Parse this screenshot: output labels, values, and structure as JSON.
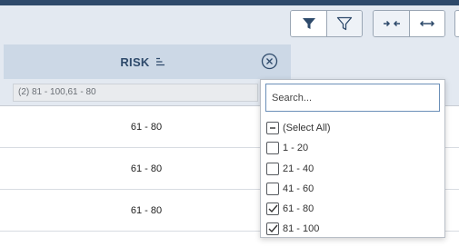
{
  "toolbar": {
    "buttons": [
      {
        "icon": "filter-filled-icon"
      },
      {
        "icon": "filter-outline-icon"
      },
      {
        "icon": "collapse-columns-icon"
      },
      {
        "icon": "expand-columns-icon"
      }
    ]
  },
  "column": {
    "title": "RISK",
    "sort_icon": "sort-lines-icon",
    "close_icon": "close-circle-icon",
    "filter_value": "(2) 81 - 100,61 - 80"
  },
  "rows": [
    {
      "risk": "61 - 80"
    },
    {
      "risk": "61 - 80"
    },
    {
      "risk": "61 - 80"
    }
  ],
  "dropdown": {
    "search_placeholder": "Search...",
    "options": [
      {
        "label": "(Select All)",
        "state": "indeterminate"
      },
      {
        "label": "1 - 20",
        "state": "unchecked"
      },
      {
        "label": "21 - 40",
        "state": "unchecked"
      },
      {
        "label": "41 - 60",
        "state": "unchecked"
      },
      {
        "label": "61 - 80",
        "state": "checked"
      },
      {
        "label": "81 - 100",
        "state": "checked"
      }
    ]
  },
  "colors": {
    "accent": "#2e4a6b",
    "header_bg": "#e3e9f1",
    "column_bg": "#ccd8e6"
  }
}
